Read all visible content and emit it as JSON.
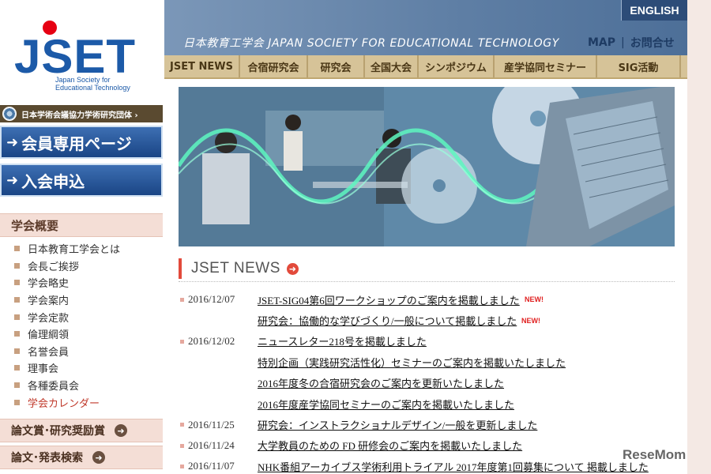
{
  "logo": {
    "mark": "JSET",
    "subtitle": "Japan Society for Educational Technology"
  },
  "affiliation": {
    "label": "日本学術会議協力学術研究団体 ›"
  },
  "sidebar": {
    "members_label": "会員専用ページ",
    "join_label": "入会申込",
    "about_heading": "学会概要",
    "about_items": [
      "日本教育工学会とは",
      "会長ご挨拶",
      "学会略史",
      "学会案内",
      "学会定款",
      "倫理綱領",
      "名誉会員",
      "理事会",
      "各種委員会",
      "学会カレンダー"
    ],
    "awards_label": "論文賞･研究奨励賞",
    "search_label": "論文･発表検索"
  },
  "header": {
    "english_label": "ENGLISH",
    "site_title": "日本教育工学会  JAPAN SOCIETY FOR EDUCATIONAL TECHNOLOGY",
    "map_label": "MAP",
    "separator": "|",
    "contact_label": "お問合せ"
  },
  "nav": {
    "tabs": [
      "JSET NEWS",
      "合宿研究会",
      "研究会",
      "全国大会",
      "シンポジウム",
      "産学協同セミナー",
      "SIG活動"
    ]
  },
  "news": {
    "heading": "JSET NEWS",
    "new_badge": "NEW!",
    "items": [
      {
        "date": "2016/12/07",
        "text": "JSET-SIG04第6回ワークショップのご案内を掲載しました",
        "new": true
      },
      {
        "date": "",
        "text": "研究会：協働的な学びづくり/一般について掲載しました",
        "new": true
      },
      {
        "date": "2016/12/02",
        "text": "ニュースレター218号を掲載しました",
        "new": false
      },
      {
        "date": "",
        "text": "特別企画（実践研究活性化）セミナーのご案内を掲載いたしました",
        "new": false
      },
      {
        "date": "",
        "text": "2016年度冬の合宿研究会のご案内を更新いたしました",
        "new": false
      },
      {
        "date": "",
        "text": "2016年度産学協同セミナーのご案内を掲載いたしました",
        "new": false
      },
      {
        "date": "2016/11/25",
        "text": "研究会：インストラクショナルデザイン/一般を更新しました",
        "new": false
      },
      {
        "date": "2016/11/24",
        "text": "大学教員のための FD 研修会のご案内を掲載いたしました",
        "new": false
      },
      {
        "date": "2016/11/07",
        "text": "NHK番組アーカイブス学術利用トライアル 2017年度第1回募集について 掲載しました",
        "new": false
      }
    ]
  },
  "watermark": "ReseMom",
  "colors": {
    "brand_blue": "#1c5aa8",
    "accent_red": "#e24a3b",
    "nav_tan": "#d6c398"
  }
}
